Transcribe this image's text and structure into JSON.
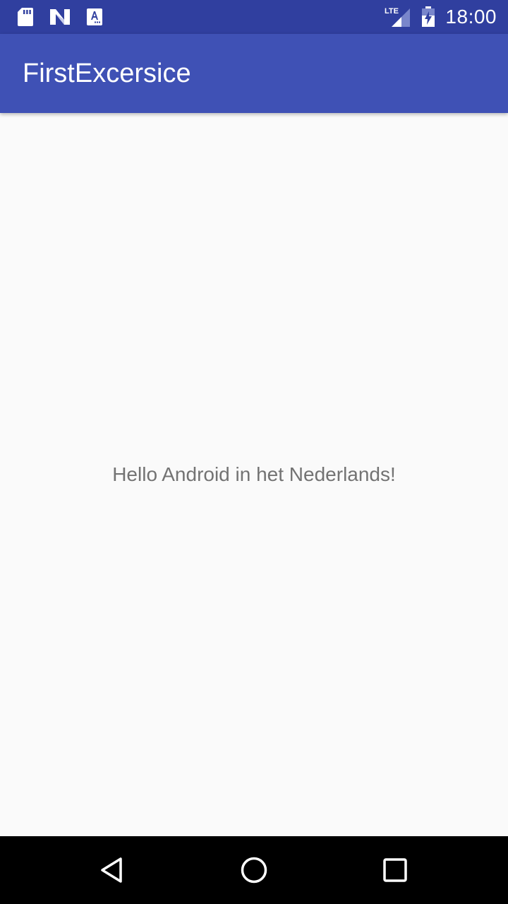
{
  "status_bar": {
    "time": "18:00",
    "network": "LTE",
    "icons": [
      "sd-card-icon",
      "n-notification-icon",
      "a-notification-icon",
      "lte-signal-icon",
      "battery-charging-icon"
    ]
  },
  "app_bar": {
    "title": "FirstExcersice"
  },
  "main": {
    "hello_text": "Hello Android in het Nederlands!"
  },
  "nav_bar": {
    "buttons": [
      "back",
      "home",
      "recents"
    ]
  },
  "colors": {
    "status_bar": "#303f9f",
    "app_bar": "#3f51b5",
    "background": "#fafafa",
    "text_secondary": "#737373",
    "nav_bar": "#000000"
  }
}
